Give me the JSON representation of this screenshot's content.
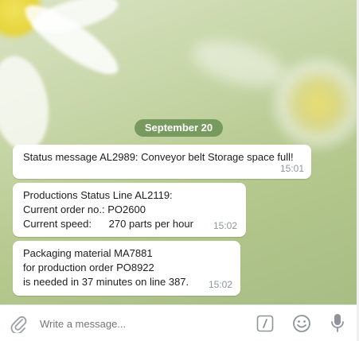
{
  "date_separator": "September 20",
  "messages": [
    {
      "lines": [
        "Status message AL2989: Conveyor belt Storage space full!"
      ],
      "time": "15:01"
    },
    {
      "lines": [
        "Productions Status Line AL2119:",
        "Current order no.: PO2600",
        "Current speed:      270 parts per hour"
      ],
      "time": "15:02"
    },
    {
      "lines": [
        "Packaging material MA7881",
        "for production order PO8922",
        "is needed in 37 minutes on line 387."
      ],
      "time": "15:02"
    }
  ],
  "composer": {
    "placeholder": "Write a message...",
    "icons": [
      "paperclip-icon",
      "slash-command-icon",
      "emoji-icon",
      "microphone-icon"
    ]
  }
}
